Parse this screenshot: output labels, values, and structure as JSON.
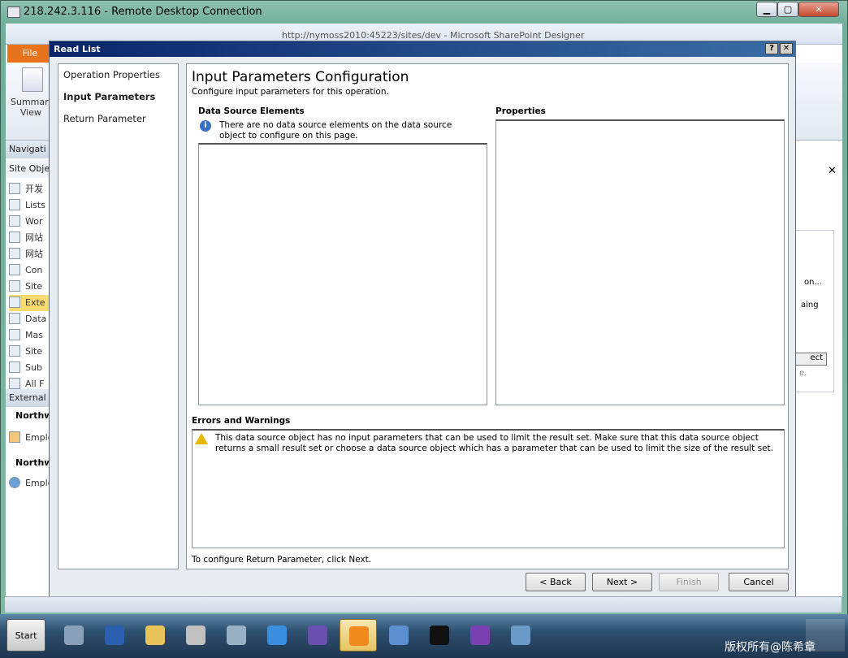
{
  "rdp": {
    "title": "218.242.3.116 - Remote Desktop Connection",
    "min_label": "▁",
    "max_label": "▢",
    "close_label": "✕"
  },
  "sharepoint": {
    "window_title": "http://nymoss2010:45223/sites/dev - Microsoft SharePoint Designer",
    "file_tab": "File",
    "summary_view": "Summary View",
    "nav_header": "Navigati",
    "site_objects_header": "Site Obje",
    "nav_items": [
      {
        "label": "开发",
        "icon": "home-icon"
      },
      {
        "label": "Lists",
        "icon": "list-icon"
      },
      {
        "label": "Wor",
        "icon": "workflow-icon"
      },
      {
        "label": "网站",
        "icon": "pages-icon"
      },
      {
        "label": "网站",
        "icon": "assets-icon"
      },
      {
        "label": "Con",
        "icon": "content-types-icon"
      },
      {
        "label": "Site",
        "icon": "site-columns-icon"
      },
      {
        "label": "Exte",
        "icon": "external-content-icon"
      },
      {
        "label": "Data",
        "icon": "data-sources-icon"
      },
      {
        "label": "Mas",
        "icon": "master-pages-icon"
      },
      {
        "label": "Site",
        "icon": "site-groups-icon"
      },
      {
        "label": "Sub",
        "icon": "subsites-icon"
      },
      {
        "label": "All F",
        "icon": "all-files-icon"
      }
    ],
    "external_header": "External",
    "northwind_1": "Northw",
    "employ_1": "Employ",
    "northwind_2": "Northw",
    "employ_2": "Employ",
    "right_panel_texts": [
      "on...",
      "aing",
      "ect",
      "e."
    ]
  },
  "dialog": {
    "title": "Read List",
    "help_label": "?",
    "close_label": "✕",
    "steps": [
      {
        "label": "Operation Properties",
        "current": false
      },
      {
        "label": "Input Parameters",
        "current": true
      },
      {
        "label": "Return Parameter",
        "current": false
      }
    ],
    "heading": "Input Parameters Configuration",
    "subheading": "Configure input parameters for this operation.",
    "dse_header": "Data Source Elements",
    "dse_info": "There are no data source elements on the data source object to configure on this page.",
    "properties_header": "Properties",
    "errors_header": "Errors and Warnings",
    "warning_text": "This data source object has no input parameters that can be used to limit the result set. Make sure that this data source object returns a small result set or choose a data source object which has a parameter that can be used to limit the size of the result set.",
    "footer_text": "To configure Return Parameter, click Next.",
    "buttons": {
      "back": "< Back",
      "next": "Next >",
      "finish": "Finish",
      "cancel": "Cancel"
    }
  },
  "taskbar": {
    "start": "Start",
    "apps": [
      {
        "icon": "server-manager-icon",
        "color": "#8aa0b8",
        "active": false
      },
      {
        "icon": "powershell-icon",
        "color": "#2a5fb0",
        "active": false
      },
      {
        "icon": "explorer-icon",
        "color": "#e8c35a",
        "active": false
      },
      {
        "icon": "tools-icon",
        "color": "#c0c0c0",
        "active": false
      },
      {
        "icon": "settings-icon",
        "color": "#9ab0c4",
        "active": false
      },
      {
        "icon": "internet-explorer-icon",
        "color": "#3a8ee0",
        "active": false
      },
      {
        "icon": "visual-studio-icon",
        "color": "#6a4fb0",
        "active": false
      },
      {
        "icon": "sharepoint-designer-icon",
        "color": "#f08a1c",
        "active": true
      },
      {
        "icon": "network-icon",
        "color": "#5a8fd0",
        "active": false
      },
      {
        "icon": "command-prompt-icon",
        "color": "#111111",
        "active": false
      },
      {
        "icon": "onenote-icon",
        "color": "#7a3fb0",
        "active": false
      },
      {
        "icon": "window-icon",
        "color": "#6a9ac8",
        "active": false
      }
    ],
    "watermark": "版权所有@陈希章"
  }
}
